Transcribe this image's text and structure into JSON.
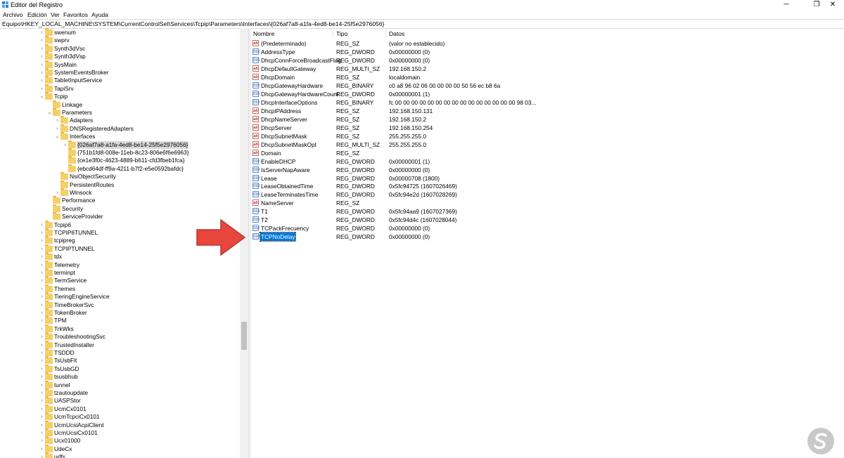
{
  "window": {
    "title": "Editor del Registro",
    "minimize": "─",
    "maximize": "❐",
    "close": "✕"
  },
  "menu": [
    "Archivo",
    "Edición",
    "Ver",
    "Favoritos",
    "Ayuda"
  ],
  "address": "Equipo\\HKEY_LOCAL_MACHINE\\SYSTEM\\CurrentControlSet\\Services\\Tcpip\\Parameters\\Interfaces\\{026af7a8-a1fa-4ed8-be14-25f5e2976056}",
  "tree": [
    {
      "label": "swenum",
      "depth": 0,
      "exp": "›"
    },
    {
      "label": "swprv",
      "depth": 0,
      "exp": "›"
    },
    {
      "label": "Synth3dVsc",
      "depth": 0,
      "exp": "›"
    },
    {
      "label": "Synth3dVsp",
      "depth": 0,
      "exp": "›"
    },
    {
      "label": "SysMain",
      "depth": 0,
      "exp": "›"
    },
    {
      "label": "SystemEventsBroker",
      "depth": 0,
      "exp": "›"
    },
    {
      "label": "TabletInputService",
      "depth": 0,
      "exp": "›"
    },
    {
      "label": "TapiSrv",
      "depth": 0,
      "exp": "›"
    },
    {
      "label": "Tcpip",
      "depth": 0,
      "exp": "⌄"
    },
    {
      "label": "Linkage",
      "depth": 1,
      "exp": ""
    },
    {
      "label": "Parameters",
      "depth": 1,
      "exp": "⌄"
    },
    {
      "label": "Adapters",
      "depth": 2,
      "exp": "›"
    },
    {
      "label": "DNSRegisteredAdapters",
      "depth": 2,
      "exp": "›"
    },
    {
      "label": "Interfaces",
      "depth": 2,
      "exp": "⌄"
    },
    {
      "label": "{026af7a8-a1fa-4ed8-be14-25f5e2976056}",
      "depth": 3,
      "exp": "›",
      "selected": true
    },
    {
      "label": "{751b1fd8-008e-11eb-8c23-806e6f6e6963}",
      "depth": 3,
      "exp": ""
    },
    {
      "label": "{ce1e3f0c-4623-4889-b611-cfd3fbeb1fca}",
      "depth": 3,
      "exp": ""
    },
    {
      "label": "{ebcd64df-ff9a-4211-b7f2-e5e0592bafdc}",
      "depth": 3,
      "exp": ""
    },
    {
      "label": "NsiObjectSecurity",
      "depth": 2,
      "exp": ""
    },
    {
      "label": "PersistentRoutes",
      "depth": 2,
      "exp": ""
    },
    {
      "label": "Winsock",
      "depth": 2,
      "exp": "›"
    },
    {
      "label": "Performance",
      "depth": 1,
      "exp": ""
    },
    {
      "label": "Security",
      "depth": 1,
      "exp": ""
    },
    {
      "label": "ServiceProvider",
      "depth": 1,
      "exp": ""
    },
    {
      "label": "Tcpip6",
      "depth": 0,
      "exp": "›"
    },
    {
      "label": "TCPIP6TUNNEL",
      "depth": 0,
      "exp": "›"
    },
    {
      "label": "tcpipreg",
      "depth": 0,
      "exp": "›"
    },
    {
      "label": "TCPIPTUNNEL",
      "depth": 0,
      "exp": "›"
    },
    {
      "label": "tdx",
      "depth": 0,
      "exp": "›"
    },
    {
      "label": "Telemetry",
      "depth": 0,
      "exp": "›"
    },
    {
      "label": "terminpt",
      "depth": 0,
      "exp": "›"
    },
    {
      "label": "TermService",
      "depth": 0,
      "exp": "›"
    },
    {
      "label": "Themes",
      "depth": 0,
      "exp": "›"
    },
    {
      "label": "TieringEngineService",
      "depth": 0,
      "exp": "›"
    },
    {
      "label": "TimeBrokerSvc",
      "depth": 0,
      "exp": "›"
    },
    {
      "label": "TokenBroker",
      "depth": 0,
      "exp": "›"
    },
    {
      "label": "TPM",
      "depth": 0,
      "exp": "›"
    },
    {
      "label": "TrkWks",
      "depth": 0,
      "exp": "›"
    },
    {
      "label": "TroubleshootingSvc",
      "depth": 0,
      "exp": "›"
    },
    {
      "label": "TrustedInstaller",
      "depth": 0,
      "exp": "›"
    },
    {
      "label": "TSDDD",
      "depth": 0,
      "exp": "›"
    },
    {
      "label": "TsUsbFlt",
      "depth": 0,
      "exp": "›"
    },
    {
      "label": "TsUsbGD",
      "depth": 0,
      "exp": "›"
    },
    {
      "label": "tsusbhub",
      "depth": 0,
      "exp": "›"
    },
    {
      "label": "tunnel",
      "depth": 0,
      "exp": "›"
    },
    {
      "label": "tzautoupdate",
      "depth": 0,
      "exp": "›"
    },
    {
      "label": "UASPStor",
      "depth": 0,
      "exp": "›"
    },
    {
      "label": "UcmCx0101",
      "depth": 0,
      "exp": "›"
    },
    {
      "label": "UcmTcpciCx0101",
      "depth": 0,
      "exp": "›"
    },
    {
      "label": "UcmUcsiAcpiClient",
      "depth": 0,
      "exp": "›"
    },
    {
      "label": "UcmUcsiCx0101",
      "depth": 0,
      "exp": "›"
    },
    {
      "label": "Ucx01000",
      "depth": 0,
      "exp": "›"
    },
    {
      "label": "UdeCx",
      "depth": 0,
      "exp": "›"
    },
    {
      "label": "udfs",
      "depth": 0,
      "exp": "›"
    }
  ],
  "columns": {
    "name": "Nombre",
    "type": "Tipo",
    "data": "Datos"
  },
  "values": [
    {
      "icon": "sz",
      "icon_text": "ab",
      "name": "(Predeterminado)",
      "type": "REG_SZ",
      "data": "(valor no establecido)"
    },
    {
      "icon": "bin",
      "icon_text": "010",
      "name": "AddressType",
      "type": "REG_DWORD",
      "data": "0x00000000 (0)"
    },
    {
      "icon": "bin",
      "icon_text": "010",
      "name": "DhcpConnForceBroadcastFlag",
      "type": "REG_DWORD",
      "data": "0x00000000 (0)"
    },
    {
      "icon": "sz",
      "icon_text": "ab",
      "name": "DhcpDefaultGateway",
      "type": "REG_MULTI_SZ",
      "data": "192.168.150.2"
    },
    {
      "icon": "sz",
      "icon_text": "ab",
      "name": "DhcpDomain",
      "type": "REG_SZ",
      "data": "localdomain"
    },
    {
      "icon": "bin",
      "icon_text": "010",
      "name": "DhcpGatewayHardware",
      "type": "REG_BINARY",
      "data": "c0 a8 96 02 06 00 00 00 00 50 56 ec b8 6a"
    },
    {
      "icon": "bin",
      "icon_text": "010",
      "name": "DhcpGatewayHardwareCount",
      "type": "REG_DWORD",
      "data": "0x00000001 (1)"
    },
    {
      "icon": "bin",
      "icon_text": "010",
      "name": "DhcpInterfaceOptions",
      "type": "REG_BINARY",
      "data": "fc 00 00 00 00 00 00 00 00 00 00 00 00 00 00 00 98 03..."
    },
    {
      "icon": "sz",
      "icon_text": "ab",
      "name": "DhcpIPAddress",
      "type": "REG_SZ",
      "data": "192.168.150.131"
    },
    {
      "icon": "sz",
      "icon_text": "ab",
      "name": "DhcpNameServer",
      "type": "REG_SZ",
      "data": "192.168.150.2"
    },
    {
      "icon": "sz",
      "icon_text": "ab",
      "name": "DhcpServer",
      "type": "REG_SZ",
      "data": "192.168.150.254"
    },
    {
      "icon": "sz",
      "icon_text": "ab",
      "name": "DhcpSubnetMask",
      "type": "REG_SZ",
      "data": "255.255.255.0"
    },
    {
      "icon": "sz",
      "icon_text": "ab",
      "name": "DhcpSubnetMaskOpt",
      "type": "REG_MULTI_SZ",
      "data": "255.255.255.0"
    },
    {
      "icon": "sz",
      "icon_text": "ab",
      "name": "Domain",
      "type": "REG_SZ",
      "data": ""
    },
    {
      "icon": "bin",
      "icon_text": "010",
      "name": "EnableDHCP",
      "type": "REG_DWORD",
      "data": "0x00000001 (1)"
    },
    {
      "icon": "bin",
      "icon_text": "010",
      "name": "IsServerNapAware",
      "type": "REG_DWORD",
      "data": "0x00000000 (0)"
    },
    {
      "icon": "bin",
      "icon_text": "010",
      "name": "Lease",
      "type": "REG_DWORD",
      "data": "0x00000708 (1800)"
    },
    {
      "icon": "bin",
      "icon_text": "010",
      "name": "LeaseObtainedTime",
      "type": "REG_DWORD",
      "data": "0x5fc94725 (1607026469)"
    },
    {
      "icon": "bin",
      "icon_text": "010",
      "name": "LeaseTerminatesTime",
      "type": "REG_DWORD",
      "data": "0x5fc94e2d (1607028269)"
    },
    {
      "icon": "sz",
      "icon_text": "ab",
      "name": "NameServer",
      "type": "REG_SZ",
      "data": ""
    },
    {
      "icon": "bin",
      "icon_text": "010",
      "name": "T1",
      "type": "REG_DWORD",
      "data": "0x5fc94aa9 (1607027369)"
    },
    {
      "icon": "bin",
      "icon_text": "010",
      "name": "T2",
      "type": "REG_DWORD",
      "data": "0x5fc94d4c (1607028044)"
    },
    {
      "icon": "bin",
      "icon_text": "010",
      "name": "TCPackFrecuency",
      "type": "REG_DWORD",
      "data": "0x00000000 (0)"
    },
    {
      "icon": "bin",
      "icon_text": "010",
      "name": "TCPNoDelay",
      "type": "REG_DWORD",
      "data": "0x00000000 (0)",
      "selected": true
    }
  ],
  "colors": {
    "selection": "#0078d7",
    "arrow": "#e8453c",
    "folder": "#f5cf69",
    "logo": "#c9c9c9"
  }
}
